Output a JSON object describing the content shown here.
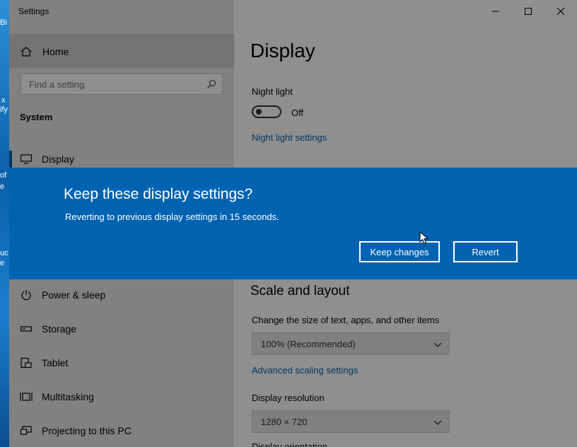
{
  "desktop": {
    "fragments": [
      "Bi",
      "x",
      "ify",
      "of",
      "e",
      "uc",
      "e"
    ]
  },
  "window": {
    "title": "Settings",
    "controls": {
      "minimize": "minimize",
      "maximize": "maximize",
      "close": "close"
    }
  },
  "sidebar": {
    "home_label": "Home",
    "search_placeholder": "Find a setting",
    "section_label": "System",
    "items": [
      {
        "label": "Display",
        "icon": "monitor-icon",
        "active": true
      },
      {
        "label": "Power & sleep",
        "icon": "power-icon"
      },
      {
        "label": "Storage",
        "icon": "storage-icon"
      },
      {
        "label": "Tablet",
        "icon": "tablet-icon"
      },
      {
        "label": "Multitasking",
        "icon": "multitasking-icon"
      },
      {
        "label": "Projecting to this PC",
        "icon": "projecting-icon"
      }
    ]
  },
  "main": {
    "title": "Display",
    "night_light": {
      "label": "Night light",
      "state": "Off",
      "settings_link": "Night light settings"
    },
    "scale_heading": "Scale and layout",
    "scale": {
      "label": "Change the size of text, apps, and other items",
      "value": "100% (Recommended)",
      "advanced_link": "Advanced scaling settings"
    },
    "resolution": {
      "label": "Display resolution",
      "value": "1280 × 720"
    },
    "orientation_partial": "Display orientation"
  },
  "dialog": {
    "title": "Keep these display settings?",
    "message": "Reverting to previous display settings in 15 seconds.",
    "keep_label": "Keep changes",
    "revert_label": "Revert"
  },
  "colors": {
    "accent": "#0063b1",
    "overlay": "rgba(0,0,0,0.44)"
  }
}
